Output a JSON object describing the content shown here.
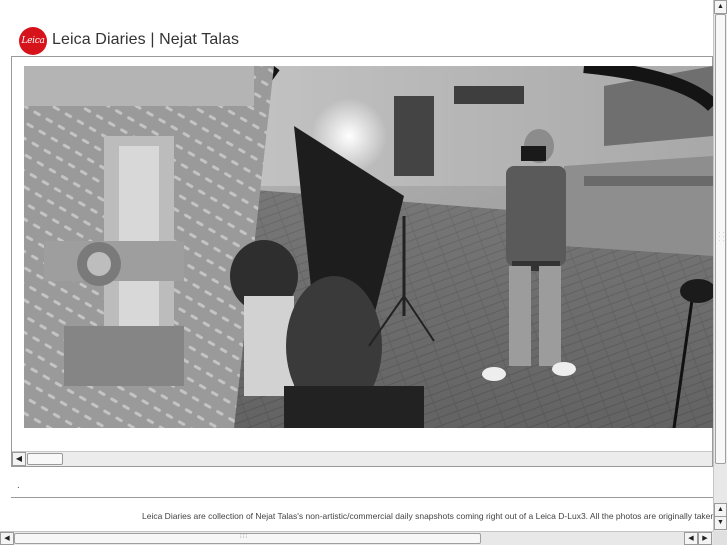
{
  "header": {
    "logo_text": "Leica",
    "title": "Leica Diaries | Nejat Talas"
  },
  "photo": {
    "icon": "photo-image"
  },
  "content": {
    "separator_dot": "."
  },
  "footer": {
    "description": "Leica Diaries are collection of Nejat Talas's non-artistic/commercial daily snapshots coming right out of a Leica D-Lux3. All the photos are originally taken"
  },
  "scrollbars": {
    "up_arrow": "▲",
    "down_arrow": "▼",
    "left_arrow": "◀",
    "right_arrow": "▶"
  },
  "colors": {
    "brand_red": "#d6121a",
    "rule_gray": "#9a9a9a"
  }
}
